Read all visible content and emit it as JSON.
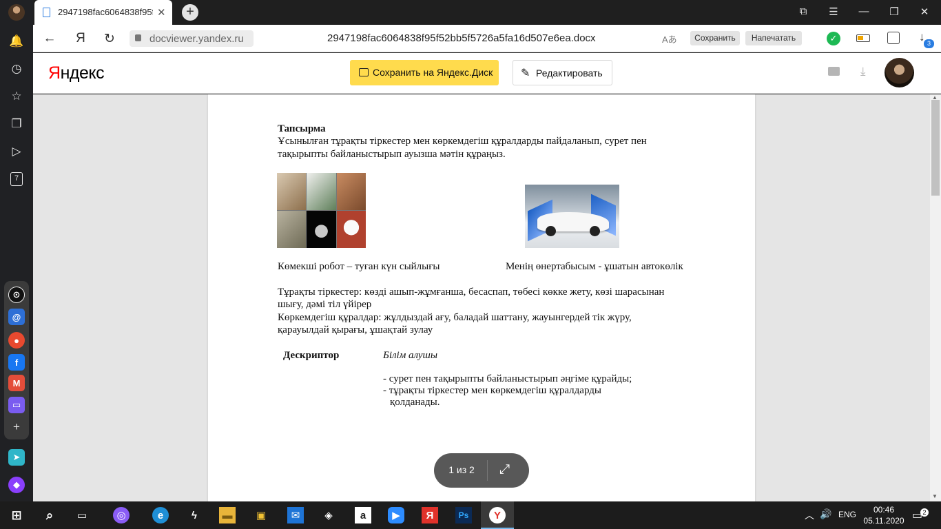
{
  "browser": {
    "tab_title": "2947198fac6064838f95f",
    "tab_close": "✕",
    "new_tab": "+",
    "window_controls": {
      "bookmarks": "⧉",
      "menu": "☰",
      "minimize": "—",
      "restore": "❐",
      "close": "✕"
    },
    "nav": {
      "back": "←",
      "yandex": "Я",
      "reload": "↻"
    },
    "domain": "docviewer.yandex.ru",
    "page_title": "2947198fac6064838f95f52bb5f5726a5fa16d507e6ea.docx",
    "translate": "Aあ",
    "save_button": "Сохранить",
    "print_button": "Напечатать",
    "extension_check": "✓",
    "download_arrow": "↓",
    "downloads_count": "3"
  },
  "sidebar": {
    "icons": [
      "bell-icon",
      "history-icon",
      "star-icon",
      "collections-icon",
      "video-icon"
    ],
    "bell": "🔔",
    "history": "◷",
    "star": "☆",
    "collections": "❐",
    "video": "▷",
    "calendar_day": "7",
    "add": "+",
    "apps": [
      {
        "name": "app-clock",
        "glyph": "⊙",
        "color": "#111111"
      },
      {
        "name": "app-mail-at",
        "glyph": "@",
        "color": "#2d6fd6"
      },
      {
        "name": "app-chrome",
        "glyph": "●",
        "color": "#e8492f"
      },
      {
        "name": "app-facebook",
        "glyph": "f",
        "color": "#1877f2"
      },
      {
        "name": "app-gmail",
        "glyph": "M",
        "color": "#e44d3a"
      },
      {
        "name": "app-messenger",
        "glyph": "▭",
        "color": "#7a5cf0"
      }
    ],
    "extra": [
      {
        "name": "app-send",
        "glyph": "➤",
        "color": "#2fb6c9"
      },
      {
        "name": "app-alice",
        "glyph": "◆",
        "color": "#8a3ffc"
      }
    ]
  },
  "header": {
    "logo_first": "Я",
    "logo_rest": "ндекс",
    "save_to_disk": "Сохранить на Яндекс.Диск",
    "edit": "Редактировать",
    "edit_icon": "✎",
    "download_icon": "⤓"
  },
  "document": {
    "heading": "Тапсырма",
    "task_line1": "Ұсынылған тұрақты тіркестер мен көркемдегіш құралдарды пайдаланып, сурет пен",
    "task_line2": "тақырыпты байланыстырып ауызша мәтін құраңыз.",
    "caption_left": "Көмекші робот – туған күн сыйлығы",
    "caption_right": "Менің өнертабысым - ұшатын автокөлік",
    "phrases_line1": "Тұрақты тіркестер: көзді ашып-жұмғанша, бесаспап, төбесі көкке жету, көзі шарасынан",
    "phrases_line2": "шығу, дәмі тіл үйірер",
    "devices_line1": "Көркемдегіш құралдар: жұлдыздай ағу, баладай шаттану, жауынгердей тік жүру,",
    "devices_line2": "қарауылдай қырағы, ұшақтай зулау",
    "descriptor_label": "Дескриптор",
    "learner_label": "Білім алушы",
    "criteria_1": "- сурет пен тақырыпты байланыстырып әңгіме құрайды;",
    "criteria_2": "- тұрақты тіркестер мен көркемдегіш құралдарды",
    "criteria_2_cont": "қолданады."
  },
  "pager": {
    "label": "1 из 2",
    "fullscreen": "⤢"
  },
  "taskbar": {
    "apps": [
      "windows-start",
      "search",
      "task-view",
      "alice",
      "edge",
      "app-vpn",
      "file-explorer",
      "store",
      "mail",
      "dropbox",
      "amazon",
      "zoom",
      "yandex-red",
      "photoshop",
      "yandex-browser"
    ],
    "start": "⊞",
    "search": "⌕",
    "task_view": "▭",
    "alice": "◎",
    "edge": "e",
    "vpn": "ϟ",
    "explorer": "▬",
    "store": "▣",
    "mail": "✉",
    "dropbox": "◈",
    "amazon": "a",
    "zoom": "▶",
    "yandex_red": "Я",
    "photoshop": "Ps",
    "yandex_browser": "Y",
    "tray_chevron": "︿",
    "volume": "🔊",
    "language": "ENG",
    "time": "00:46",
    "date": "05.11.2020",
    "notifications": "2"
  }
}
